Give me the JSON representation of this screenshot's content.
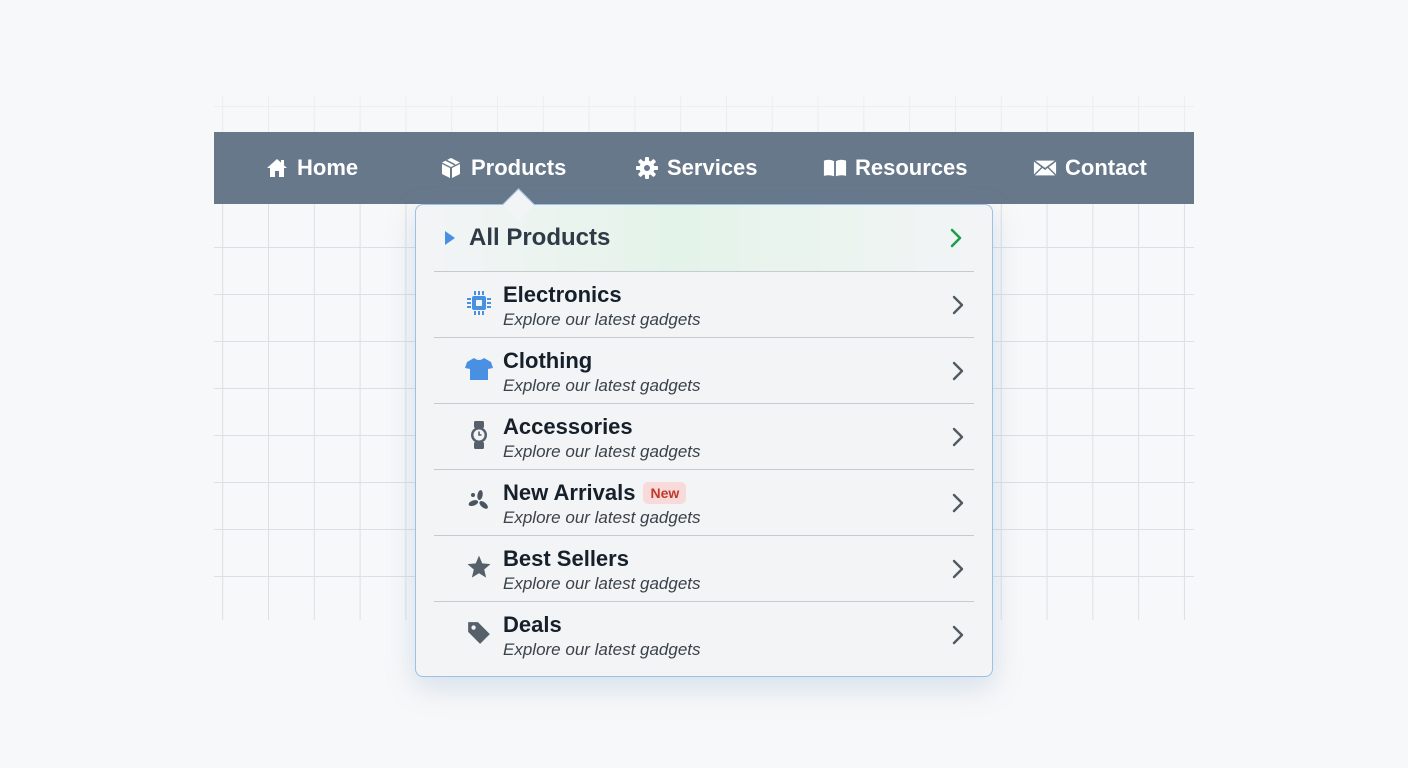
{
  "nav": {
    "items": [
      {
        "label": "Home",
        "icon": "home-icon"
      },
      {
        "label": "Products",
        "icon": "box-icon"
      },
      {
        "label": "Services",
        "icon": "gear-icon"
      },
      {
        "label": "Resources",
        "icon": "book-icon"
      },
      {
        "label": "Contact",
        "icon": "envelope-icon"
      }
    ]
  },
  "dropdown": {
    "header": {
      "label": "All Products",
      "icon": "play-triangle-icon"
    },
    "items": [
      {
        "title": "Electronics",
        "desc": "Explore our latest gadgets",
        "icon": "chip-icon"
      },
      {
        "title": "Clothing",
        "desc": "Explore our latest gadgets",
        "icon": "tshirt-icon"
      },
      {
        "title": "Accessories",
        "desc": "Explore our latest gadgets",
        "icon": "watch-icon"
      },
      {
        "title": "New Arrivals",
        "desc": "Explore our latest gadgets",
        "icon": "sparkle-icon",
        "badge": "New"
      },
      {
        "title": "Best Sellers",
        "desc": "Explore our latest gadgets",
        "icon": "star-icon"
      },
      {
        "title": "Deals",
        "desc": "Explore our latest gadgets",
        "icon": "tag-icon"
      }
    ]
  },
  "colors": {
    "navbar": "#67788a",
    "accent_blue": "#4a90e2",
    "accent_green": "#1e9e4a",
    "badge_red": "#c0392b"
  }
}
